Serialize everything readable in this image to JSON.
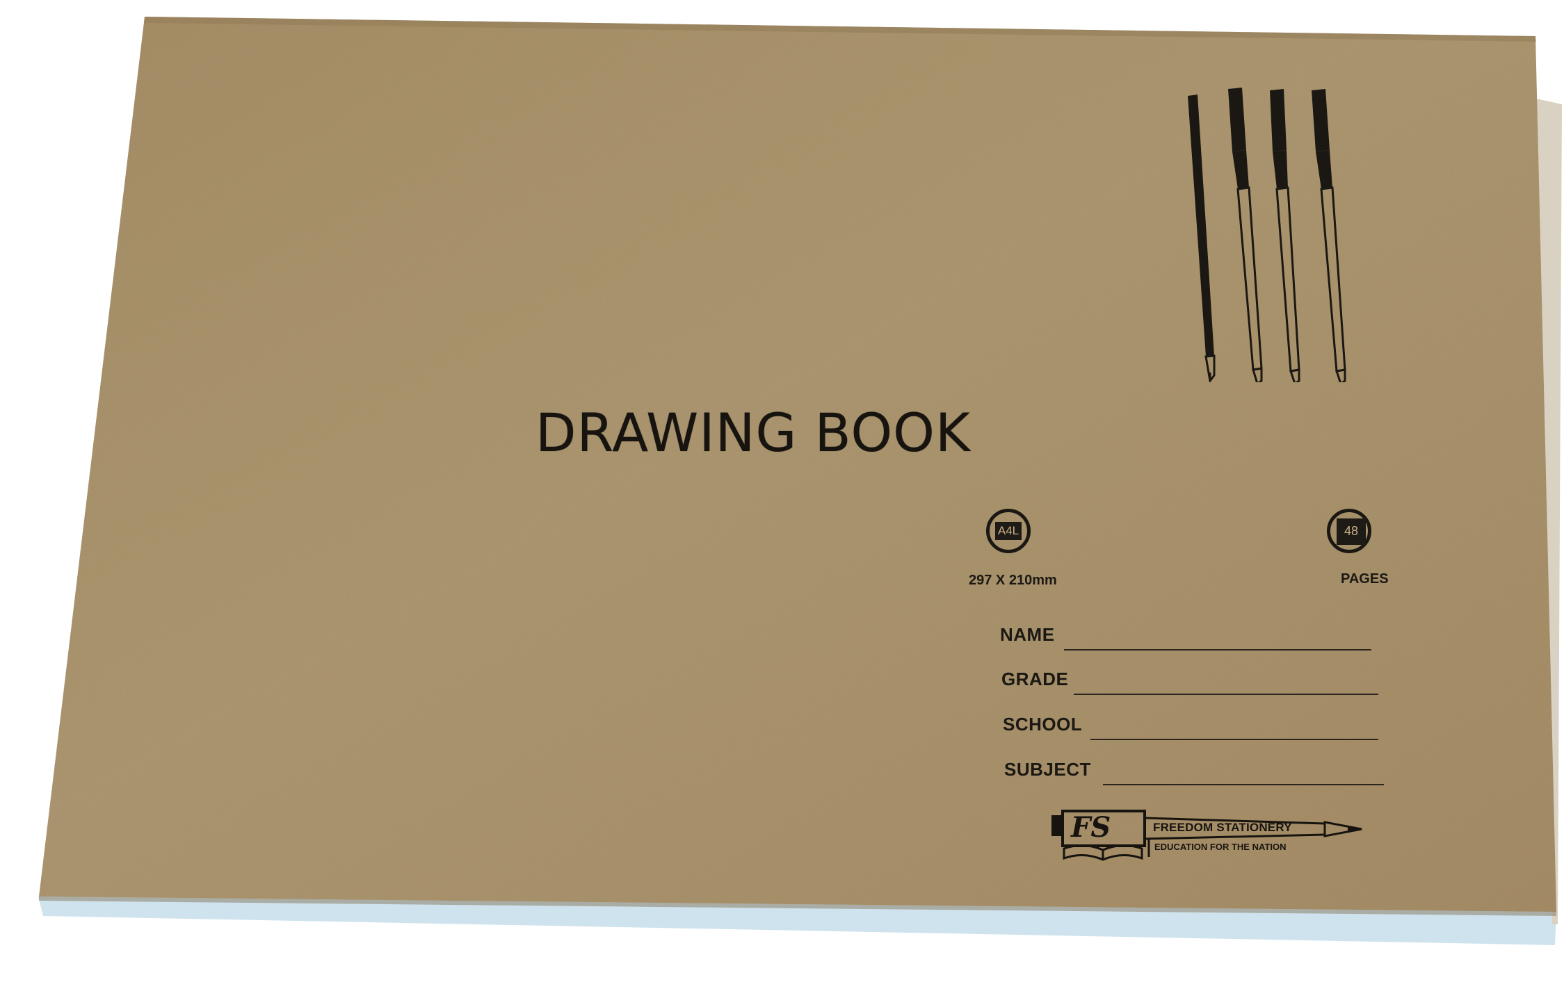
{
  "cover": {
    "title": "DRAWING BOOK",
    "paper_color": "#ac9670",
    "ink_color": "#1b1813"
  },
  "specs": {
    "size_badge": "A4L",
    "size_caption": "297 X 210mm",
    "pages_badge": "48",
    "pages_caption": "PAGES"
  },
  "fields": {
    "name": "NAME",
    "grade": "GRADE",
    "school": "SCHOOL",
    "subject": "SUBJECT"
  },
  "brand": {
    "monogram": "FS",
    "name": "FREEDOM STATIONERY",
    "tagline": "EDUCATION FOR THE NATION"
  },
  "icons": [
    "pencil-icon",
    "pen-icon",
    "pen-icon",
    "pen-icon",
    "pencil-tip-icon",
    "book-icon"
  ]
}
